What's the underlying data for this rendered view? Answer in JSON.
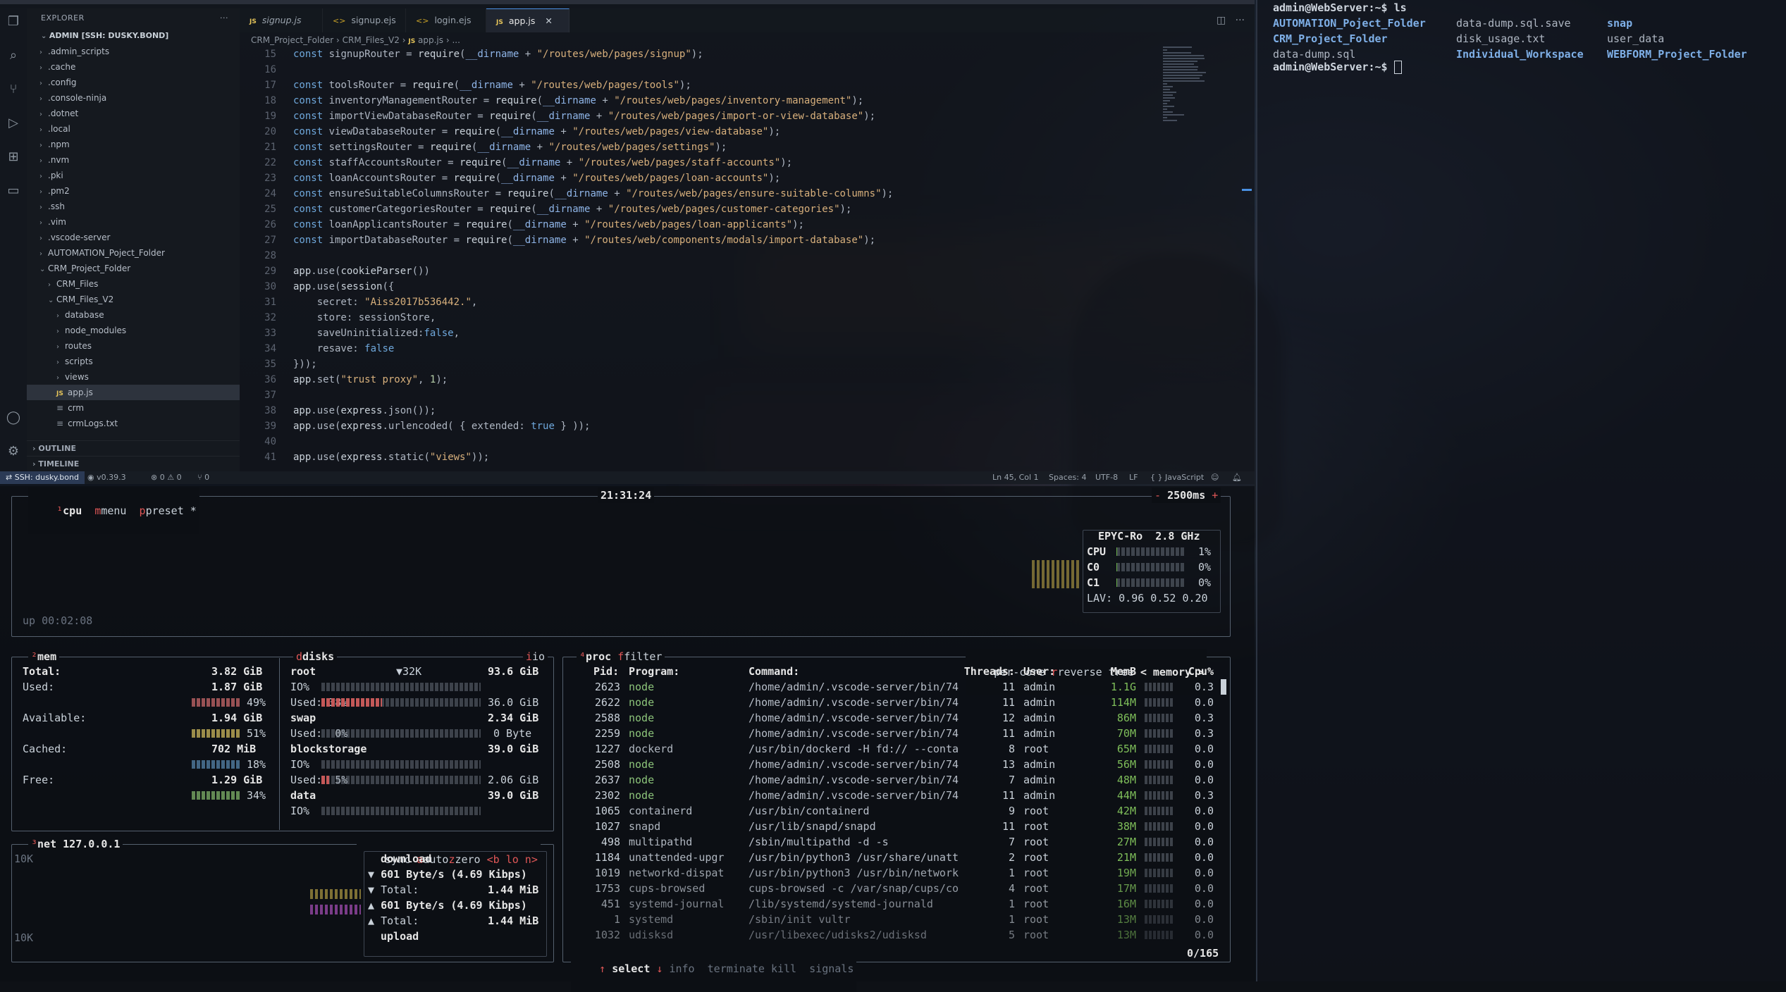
{
  "explorer": {
    "title": "EXPLORER",
    "root_label": "ADMIN [SSH: DUSKY.BOND]",
    "items": [
      {
        "label": ".admin_scripts",
        "type": "folder",
        "depth": 1
      },
      {
        "label": ".cache",
        "type": "folder",
        "depth": 1
      },
      {
        "label": ".config",
        "type": "folder",
        "depth": 1
      },
      {
        "label": ".console-ninja",
        "type": "folder",
        "depth": 1
      },
      {
        "label": ".dotnet",
        "type": "folder",
        "depth": 1
      },
      {
        "label": ".local",
        "type": "folder",
        "depth": 1
      },
      {
        "label": ".npm",
        "type": "folder",
        "depth": 1
      },
      {
        "label": ".nvm",
        "type": "folder",
        "depth": 1
      },
      {
        "label": ".pki",
        "type": "folder",
        "depth": 1
      },
      {
        "label": ".pm2",
        "type": "folder",
        "depth": 1
      },
      {
        "label": ".ssh",
        "type": "folder",
        "depth": 1
      },
      {
        "label": ".vim",
        "type": "folder",
        "depth": 1
      },
      {
        "label": ".vscode-server",
        "type": "folder",
        "depth": 1
      },
      {
        "label": "AUTOMATION_Poject_Folder",
        "type": "folder",
        "depth": 1
      },
      {
        "label": "CRM_Project_Folder",
        "type": "folder-open",
        "depth": 1
      },
      {
        "label": "CRM_Files",
        "type": "folder",
        "depth": 2
      },
      {
        "label": "CRM_Files_V2",
        "type": "folder-open",
        "depth": 2
      },
      {
        "label": "database",
        "type": "folder",
        "depth": 3
      },
      {
        "label": "node_modules",
        "type": "folder",
        "depth": 3
      },
      {
        "label": "routes",
        "type": "folder",
        "depth": 3
      },
      {
        "label": "scripts",
        "type": "folder",
        "depth": 3
      },
      {
        "label": "views",
        "type": "folder",
        "depth": 3
      },
      {
        "label": "app.js",
        "type": "js",
        "depth": 3,
        "active": true
      },
      {
        "label": "crm",
        "type": "file",
        "depth": 3
      },
      {
        "label": "crmLogs.txt",
        "type": "file",
        "depth": 3
      }
    ],
    "outline": "OUTLINE",
    "timeline": "TIMELINE"
  },
  "tabs": [
    {
      "label": "signup.js",
      "kind": "js",
      "italic": true
    },
    {
      "label": "signup.ejs",
      "kind": "ejs"
    },
    {
      "label": "login.ejs",
      "kind": "ejs"
    },
    {
      "label": "app.js",
      "kind": "js",
      "active": true
    }
  ],
  "breadcrumb": [
    "CRM_Project_Folder",
    "CRM_Files_V2",
    "JS",
    "app.js",
    "..."
  ],
  "code": {
    "lines": [
      {
        "n": "15",
        "t": "const signupRouter = require(__dirname + \"/routes/web/pages/signup\");"
      },
      {
        "n": "16",
        "t": ""
      },
      {
        "n": "17",
        "t": "const toolsRouter = require(__dirname + \"/routes/web/pages/tools\");"
      },
      {
        "n": "18",
        "t": "const inventoryManagementRouter = require(__dirname + \"/routes/web/pages/inventory-management\");"
      },
      {
        "n": "19",
        "t": "const importViewDatabaseRouter = require(__dirname + \"/routes/web/pages/import-or-view-database\");"
      },
      {
        "n": "20",
        "t": "const viewDatabaseRouter = require(__dirname + \"/routes/web/pages/view-database\");"
      },
      {
        "n": "21",
        "t": "const settingsRouter = require(__dirname + \"/routes/web/pages/settings\");"
      },
      {
        "n": "22",
        "t": "const staffAccountsRouter = require(__dirname + \"/routes/web/pages/staff-accounts\");"
      },
      {
        "n": "23",
        "t": "const loanAccountsRouter = require(__dirname + \"/routes/web/pages/loan-accounts\");"
      },
      {
        "n": "24",
        "t": "const ensureSuitableColumnsRouter = require(__dirname + \"/routes/web/pages/ensure-suitable-columns\");"
      },
      {
        "n": "25",
        "t": "const customerCategoriesRouter = require(__dirname + \"/routes/web/pages/customer-categories\");"
      },
      {
        "n": "26",
        "t": "const loanApplicantsRouter = require(__dirname + \"/routes/web/pages/loan-applicants\");"
      },
      {
        "n": "27",
        "t": "const importDatabaseRouter = require(__dirname + \"/routes/web/components/modals/import-database\");"
      },
      {
        "n": "28",
        "t": ""
      },
      {
        "n": "29",
        "t": "app.use(cookieParser())"
      },
      {
        "n": "30",
        "t": "app.use(session({"
      },
      {
        "n": "31",
        "t": "    secret: \"Aiss2017b536442.\","
      },
      {
        "n": "32",
        "t": "    store: sessionStore,"
      },
      {
        "n": "33",
        "t": "    saveUninitialized:false,"
      },
      {
        "n": "34",
        "t": "    resave: false"
      },
      {
        "n": "35",
        "t": "}));"
      },
      {
        "n": "36",
        "t": "app.set(\"trust proxy\", 1);"
      },
      {
        "n": "37",
        "t": ""
      },
      {
        "n": "38",
        "t": "app.use(express.json());"
      },
      {
        "n": "39",
        "t": "app.use(express.urlencoded( { extended: true } ));"
      },
      {
        "n": "40",
        "t": ""
      },
      {
        "n": "41",
        "t": "app.use(express.static(\"views\"));"
      }
    ]
  },
  "statusbar": {
    "remote": "SSH: dusky.bond",
    "version": "v0.39.3",
    "errors": "0",
    "warnings": "0",
    "ports": "0",
    "position": "Ln 45, Col 1",
    "spaces": "Spaces: 4",
    "encoding": "UTF-8",
    "eol": "LF",
    "language": "JavaScript"
  },
  "btop": {
    "cpu_box": {
      "title_cpu": "cpu",
      "title_menu": "menu",
      "title_preset": "preset *",
      "clock": "21:31:24",
      "interval": "2500ms",
      "uptime": "up 00:02:08",
      "cpu_model": "EPYC-Ro",
      "freq": "2.8 GHz",
      "rows": [
        {
          "label": "CPU",
          "pct": "1%",
          "value": 1
        },
        {
          "label": "C0",
          "pct": "0%",
          "value": 0
        },
        {
          "label": "C1",
          "pct": "0%",
          "value": 0
        }
      ],
      "lav": "LAV: 0.96 0.52 0.20"
    },
    "mem_box": {
      "title": "mem",
      "total_label": "Total:",
      "total": "3.82 GiB",
      "used_label": "Used:",
      "used": "1.87 GiB",
      "used_pct": "49%",
      "available_label": "Available:",
      "available": "1.94 GiB",
      "available_pct": "51%",
      "cached_label": "Cached:",
      "cached": "702 MiB",
      "cached_pct": "18%",
      "free_label": "Free:",
      "free": "1.29 GiB",
      "free_pct": "34%"
    },
    "disks_box": {
      "title": "disks",
      "io_tag": "io",
      "root": {
        "name": "root",
        "speed": "▼32K",
        "total": "93.6 GiB",
        "io": "IO%",
        "used_label": "Used: 38%",
        "used": "36.0 GiB",
        "used_value": 38
      },
      "swap": {
        "name": "swap",
        "total": "2.34 GiB",
        "used_label": "Used:  0%",
        "used": "0 Byte",
        "used_value": 0
      },
      "blockstorage": {
        "name": "blockstorage",
        "total": "39.0 GiB",
        "io": "IO%",
        "used_label": "Used:  5%",
        "used": "2.06 GiB",
        "used_value": 5
      },
      "data": {
        "name": "data",
        "total": "39.0 GiB",
        "io": "IO%"
      }
    },
    "net_box": {
      "title": "net",
      "iface": "127.0.0.1",
      "opts": [
        "sync",
        "auto",
        "zero",
        "<b lo n>"
      ],
      "scale_top": "10K",
      "scale_bottom": "10K",
      "download": "download",
      "dl_rate": "601 Byte/s (4.69 Kibps)",
      "dl_total_label": "Total:",
      "dl_total": "1.44 MiB",
      "ul_rate": "601 Byte/s (4.69 Kibps)",
      "ul_total_label": "Total:",
      "ul_total": "1.44 MiB",
      "upload": "upload"
    },
    "proc_box": {
      "title": "proc",
      "filter": "filter",
      "opts": [
        "per-core",
        "reverse",
        "tree",
        "< memory >"
      ],
      "headers": [
        "Pid:",
        "Program:",
        "Command:",
        "Threads:",
        "User:",
        "MemB",
        "Cpu%"
      ],
      "rows": [
        {
          "pid": "2623",
          "prog": "node",
          "cmd": "/home/admin/.vscode-server/bin/74",
          "thr": "11",
          "user": "admin",
          "mem": "1.1G",
          "cpu": "0.3"
        },
        {
          "pid": "2622",
          "prog": "node",
          "cmd": "/home/admin/.vscode-server/bin/74",
          "thr": "11",
          "user": "admin",
          "mem": "114M",
          "cpu": "0.0"
        },
        {
          "pid": "2588",
          "prog": "node",
          "cmd": "/home/admin/.vscode-server/bin/74",
          "thr": "12",
          "user": "admin",
          "mem": "86M",
          "cpu": "0.3"
        },
        {
          "pid": "2259",
          "prog": "node",
          "cmd": "/home/admin/.vscode-server/bin/74",
          "thr": "11",
          "user": "admin",
          "mem": "70M",
          "cpu": "0.3"
        },
        {
          "pid": "1227",
          "prog": "dockerd",
          "cmd": "/usr/bin/dockerd -H fd:// --conta",
          "thr": "8",
          "user": "root",
          "mem": "65M",
          "cpu": "0.0"
        },
        {
          "pid": "2508",
          "prog": "node",
          "cmd": "/home/admin/.vscode-server/bin/74",
          "thr": "13",
          "user": "admin",
          "mem": "56M",
          "cpu": "0.0"
        },
        {
          "pid": "2637",
          "prog": "node",
          "cmd": "/home/admin/.vscode-server/bin/74",
          "thr": "7",
          "user": "admin",
          "mem": "48M",
          "cpu": "0.0"
        },
        {
          "pid": "2302",
          "prog": "node",
          "cmd": "/home/admin/.vscode-server/bin/74",
          "thr": "11",
          "user": "admin",
          "mem": "44M",
          "cpu": "0.3"
        },
        {
          "pid": "1065",
          "prog": "containerd",
          "cmd": "/usr/bin/containerd",
          "thr": "9",
          "user": "root",
          "mem": "42M",
          "cpu": "0.0"
        },
        {
          "pid": "1027",
          "prog": "snapd",
          "cmd": "/usr/lib/snapd/snapd",
          "thr": "11",
          "user": "root",
          "mem": "38M",
          "cpu": "0.0"
        },
        {
          "pid": "498",
          "prog": "multipathd",
          "cmd": "/sbin/multipathd -d -s",
          "thr": "7",
          "user": "root",
          "mem": "27M",
          "cpu": "0.0"
        },
        {
          "pid": "1184",
          "prog": "unattended-upgr",
          "cmd": "/usr/bin/python3 /usr/share/unatt",
          "thr": "2",
          "user": "root",
          "mem": "21M",
          "cpu": "0.0"
        },
        {
          "pid": "1019",
          "prog": "networkd-dispat",
          "cmd": "/usr/bin/python3 /usr/bin/network",
          "thr": "1",
          "user": "root",
          "mem": "19M",
          "cpu": "0.0"
        },
        {
          "pid": "1753",
          "prog": "cups-browsed",
          "cmd": "cups-browsed -c /var/snap/cups/co",
          "thr": "4",
          "user": "root",
          "mem": "17M",
          "cpu": "0.0"
        },
        {
          "pid": "451",
          "prog": "systemd-journal",
          "cmd": "/lib/systemd/systemd-journald",
          "thr": "1",
          "user": "root",
          "mem": "16M",
          "cpu": "0.0"
        },
        {
          "pid": "1",
          "prog": "systemd",
          "cmd": "/sbin/init vultr",
          "thr": "1",
          "user": "root",
          "mem": "13M",
          "cpu": "0.0"
        },
        {
          "pid": "1032",
          "prog": "udisksd",
          "cmd": "/usr/libexec/udisks2/udisksd",
          "thr": "5",
          "user": "root",
          "mem": "13M",
          "cpu": "0.0"
        }
      ],
      "footer": {
        "select": "select",
        "info": "info",
        "terminate": "terminate",
        "kill": "kill",
        "signals": "signals",
        "count": "0/165"
      }
    }
  },
  "terminal": {
    "prompt1": "admin@WebServer:~$ ls",
    "ls": [
      {
        "name": "AUTOMATION_Poject_Folder",
        "kind": "dir"
      },
      {
        "name": "data-dump.sql.save",
        "kind": "file"
      },
      {
        "name": "snap",
        "kind": "dir"
      },
      {
        "name": "CRM_Project_Folder",
        "kind": "dir"
      },
      {
        "name": "disk_usage.txt",
        "kind": "file"
      },
      {
        "name": "user_data",
        "kind": "file"
      },
      {
        "name": "data-dump.sql",
        "kind": "file"
      },
      {
        "name": "Individual_Workspace",
        "kind": "dir"
      },
      {
        "name": "WEBFORM_Project_Folder",
        "kind": "dir"
      }
    ],
    "prompt2": "admin@WebServer:~$ "
  },
  "colors": {
    "accent": "#4a90e2",
    "btop_red": "#e05757",
    "mem_used": "#c45858",
    "mem_available": "#c9b04a",
    "mem_cached": "#4a8fc4",
    "mem_free": "#7fbf5a",
    "dir": "#7fb0e8"
  }
}
